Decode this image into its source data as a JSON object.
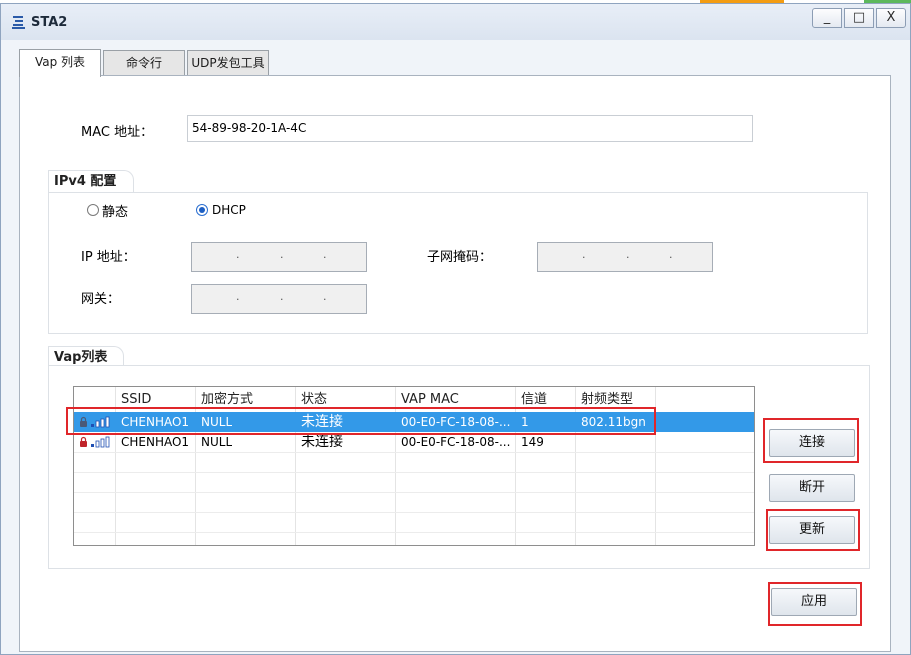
{
  "window": {
    "title": "STA2",
    "controls": {
      "minimize": "_",
      "maximize": "□",
      "close": "X"
    }
  },
  "tabs": [
    {
      "label": "Vap 列表",
      "active": true
    },
    {
      "label": "命令行",
      "active": false
    },
    {
      "label": "UDP发包工具",
      "active": false
    }
  ],
  "mac": {
    "label": "MAC 地址：",
    "value": "54-89-98-20-1A-4C"
  },
  "ipv4": {
    "group_title": "IPv4 配置",
    "static_label": "静态",
    "dhcp_label": "DHCP",
    "dhcp_selected": true,
    "ip_label": "IP 地址：",
    "mask_label": "子网掩码：",
    "gateway_label": "网关："
  },
  "vap": {
    "group_title": "Vap列表",
    "columns": [
      "",
      "SSID",
      "加密方式",
      "状态",
      "VAP MAC",
      "信道",
      "射频类型"
    ],
    "rows": [
      {
        "ssid": "CHENHAO1",
        "enc": "NULL",
        "status": "未连接",
        "mac": "00-E0-FC-18-08-...",
        "channel": "1",
        "radio": "802.11bgn",
        "selected": true
      },
      {
        "ssid": "CHENHAO1",
        "enc": "NULL",
        "status": "未连接",
        "mac": "00-E0-FC-18-08-...",
        "channel": "149",
        "radio": "",
        "selected": false
      }
    ]
  },
  "buttons": {
    "connect": "连接",
    "disconnect": "断开",
    "refresh": "更新",
    "apply": "应用"
  },
  "colors": {
    "selection": "#3399e8",
    "highlight": "#e0262a",
    "radio_checked": "#1d5fc3"
  }
}
